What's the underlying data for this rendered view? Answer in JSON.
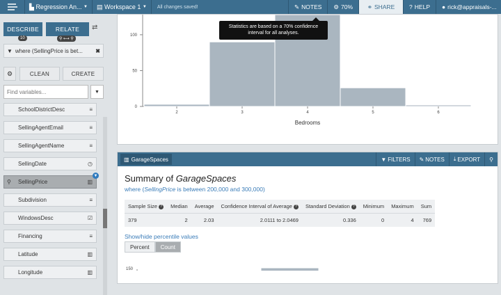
{
  "topbar": {
    "crumb1": "Regression An...",
    "crumb2": "Workspace 1",
    "saved": "All changes saved!",
    "notes": "NOTES",
    "confidence": "70%",
    "share": "SHARE",
    "help": "HELP",
    "user": "rick@appraisals-..."
  },
  "tooltip": "Statistics are based on a 70% confidence interval for all analyses.",
  "sidebar": {
    "describe": "DESCRIBE",
    "describe_badge": "10",
    "relate": "RELATE",
    "filter_text": "where (SellingPrice is bet...",
    "clean": "CLEAN",
    "create": "CREATE",
    "find_placeholder": "Find variables...",
    "variables": [
      {
        "name": "SchoolDistrictDesc",
        "icon": "≡"
      },
      {
        "name": "SellingAgentEmail",
        "icon": "≡"
      },
      {
        "name": "SellingAgentName",
        "icon": "≡"
      },
      {
        "name": "SellingDate",
        "icon": "◷"
      },
      {
        "name": "SellingPrice",
        "icon": "▥"
      },
      {
        "name": "Subdivision",
        "icon": "≡"
      },
      {
        "name": "WindowsDesc",
        "icon": "☑"
      },
      {
        "name": "Financing",
        "icon": "≡"
      },
      {
        "name": "Latitude",
        "icon": "▥"
      },
      {
        "name": "Longitude",
        "icon": "▥"
      }
    ]
  },
  "chart_top": {
    "xlabel": "Bedrooms",
    "yticks": [
      "100",
      "50",
      "0"
    ],
    "xticks": [
      "2",
      "3",
      "4",
      "5",
      "6"
    ]
  },
  "card2": {
    "tab": "GarageSpaces",
    "filters": "FILTERS",
    "notes": "NOTES",
    "export": "EXPORT",
    "title_prefix": "Summary of ",
    "title_var": "GarageSpaces",
    "where_prefix": "where (",
    "where_var": "SellingPrice",
    "where_suffix": " is between 200,000 and 300,000)",
    "showhide": "Show/hide percentile values",
    "seg_percent": "Percent",
    "seg_count": "Count",
    "ytick": "150"
  },
  "stats": {
    "headers": [
      "Sample Size",
      "Median",
      "Average",
      "Confidence Interval of Average",
      "Standard Deviation",
      "Minimum",
      "Maximum",
      "Sum"
    ],
    "values": [
      "379",
      "2",
      "2.03",
      "2.0111 to 2.0469",
      "0.336",
      "0",
      "4",
      "769"
    ]
  },
  "chart_data": [
    {
      "type": "bar",
      "xlabel": "Bedrooms",
      "ylabel": "",
      "ylim": [
        0,
        130
      ],
      "categories": [
        "2",
        "3",
        "4",
        "5",
        "6"
      ],
      "values": [
        3,
        90,
        128,
        26,
        2
      ]
    }
  ]
}
